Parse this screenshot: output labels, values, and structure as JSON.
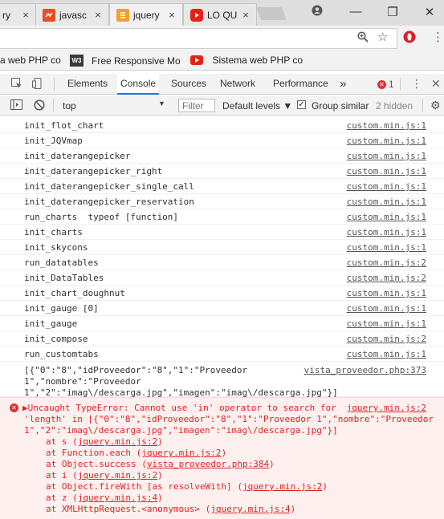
{
  "browser": {
    "tabs": [
      {
        "title": "ry",
        "favicon": "",
        "close": "×"
      },
      {
        "title": "javasc",
        "favicon": "js-icon",
        "close": "×"
      },
      {
        "title": "jquery",
        "favicon": "js-icon",
        "close": "×"
      },
      {
        "title": "LO QU",
        "favicon": "youtube-icon",
        "close": "×"
      }
    ],
    "bookmarks": [
      {
        "label": "a web PHP co",
        "icon": ""
      },
      {
        "label": "Free Responsive Mo",
        "icon": "w3-icon",
        "icon_text": "W3"
      },
      {
        "label": "Sistema web PHP co",
        "icon": "youtube-icon"
      }
    ]
  },
  "devtools": {
    "tabs": [
      "Elements",
      "Console",
      "Sources",
      "Network",
      "Performance"
    ],
    "more": "»",
    "error_count": "1",
    "toolbar": {
      "context": "top",
      "filter_placeholder": "Filter",
      "levels": "Default levels ▼",
      "group_similar": "Group similar",
      "hidden_count": "2 hidden"
    }
  },
  "console": {
    "rows": [
      {
        "message": "init_flot_chart",
        "source": "custom.min.js:1"
      },
      {
        "message": "init_JQVmap",
        "source": "custom.min.js:1"
      },
      {
        "message": "init_daterangepicker",
        "source": "custom.min.js:1"
      },
      {
        "message": "init_daterangepicker_right",
        "source": "custom.min.js:1"
      },
      {
        "message": "init_daterangepicker_single_call",
        "source": "custom.min.js:1"
      },
      {
        "message": "init_daterangepicker_reservation",
        "source": "custom.min.js:1"
      },
      {
        "message": "run_charts  typeof [function]",
        "source": "custom.min.js:1"
      },
      {
        "message": "init_charts",
        "source": "custom.min.js:1"
      },
      {
        "message": "init_skycons",
        "source": "custom.min.js:1"
      },
      {
        "message": "run_datatables",
        "source": "custom.min.js:2"
      },
      {
        "message": "init_DataTables",
        "source": "custom.min.js:2"
      },
      {
        "message": "init_chart_doughnut",
        "source": "custom.min.js:1"
      },
      {
        "message": "init_gauge [0]",
        "source": "custom.min.js:1"
      },
      {
        "message": "init_gauge",
        "source": "custom.min.js:1"
      },
      {
        "message": "init_compose",
        "source": "custom.min.js:2"
      },
      {
        "message": "run_customtabs",
        "source": "custom.min.js:1"
      }
    ],
    "object_row": {
      "lines": [
        "[{\"0\":\"8\",\"idProveedor\":\"8\",\"1\":\"Proveedor",
        "1\",\"nombre\":\"Proveedor",
        "1\",\"2\":\"imag\\/descarga.jpg\",\"imagen\":\"imag\\/descarga.jpg\"}]"
      ],
      "source": "vista_proveedor.php:373"
    },
    "error": {
      "icon": "✕",
      "headline": "▶Uncaught TypeError: Cannot use 'in' operator to search for",
      "source": "jquery.min.js:2",
      "detail_1": "'length' in [{\"0\":\"8\",\"idProveedor\":\"8\",\"1\":\"Proveedor 1\",\"nombre\":\"Proveedor",
      "detail_2": "1\",\"2\":\"imag\\/descarga.jpg\",\"imagen\":\"imag\\/descarga.jpg\"}]",
      "stack": [
        {
          "prefix": "at s (",
          "link": "jquery.min.js:2",
          "suffix": ")"
        },
        {
          "prefix": "at Function.each (",
          "link": "jquery.min.js:2",
          "suffix": ")"
        },
        {
          "prefix": "at Object.success (",
          "link": "vista_proveedor.php:384",
          "suffix": ")"
        },
        {
          "prefix": "at i (",
          "link": "jquery.min.js:2",
          "suffix": ")"
        },
        {
          "prefix": "at Object.fireWith [as resolveWith] (",
          "link": "jquery.min.js:2",
          "suffix": ")"
        },
        {
          "prefix": "at z (",
          "link": "jquery.min.js:4",
          "suffix": ")"
        },
        {
          "prefix": "at XMLHttpRequest.<anonymous> (",
          "link": "jquery.min.js:4",
          "suffix": ")"
        }
      ]
    }
  }
}
